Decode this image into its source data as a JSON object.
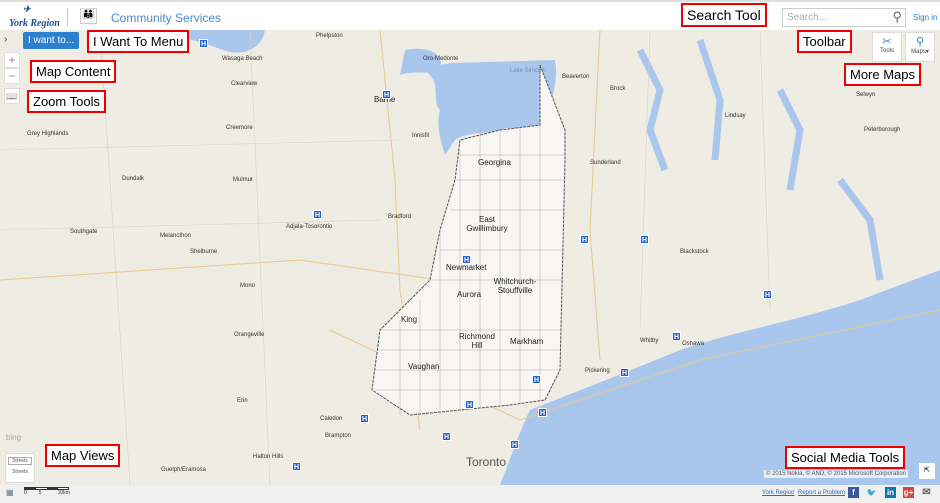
{
  "header": {
    "logo": "York Region",
    "title": "Community Services",
    "search_placeholder": "Search...",
    "sign_in": "Sign in"
  },
  "map": {
    "i_want_to": "I want to...",
    "toolbar": {
      "tools": "Tools",
      "maps": "Maps▾"
    },
    "zoom_in": "+",
    "zoom_out": "−",
    "bing": "bing",
    "streets_alt": "Streets",
    "streets": "Streets",
    "copyright": "© 2015 Nokia, © AND, © 2015 Microsoft Corporation",
    "municipalities": [
      "Georgina",
      "East Gwillimbury",
      "Newmarket",
      "Whitchurch-Stouffville",
      "Aurora",
      "King",
      "Richmond Hill",
      "Markham",
      "Vaughan",
      "Toronto"
    ],
    "places": [
      "Phelpston",
      "Oro-Medonte",
      "Wasaga Beach",
      "Clearview",
      "Barrie",
      "Beaverton",
      "Brock",
      "Lindsay",
      "Peterborough",
      "Creemore",
      "Grey Highlands",
      "Innisfil",
      "Mulmur",
      "Dundalk",
      "Bradford",
      "Melancthon",
      "Southgate",
      "Shelburne",
      "Mono",
      "Orangeville",
      "Caledon",
      "Brampton",
      "Pickering",
      "Whitby",
      "Oshawa",
      "Halton Hills",
      "Guelph/Eramosa",
      "Erin",
      "Adjala-Tosorontio",
      "Lake Simcoe",
      "Sunderland",
      "Selwyn",
      "Blackstock"
    ],
    "colors": {
      "land": "#efece4",
      "water": "#a9c6ec",
      "hospital": "#2563d9",
      "accent": "#2d7fd0"
    }
  },
  "footer": {
    "scale": [
      "0",
      "5",
      "10km"
    ],
    "links": [
      "York Region",
      "Report a Problem"
    ],
    "social": [
      "facebook-icon",
      "twitter-icon",
      "linkedin-icon",
      "googleplus-icon",
      "email-icon"
    ]
  },
  "annotations": [
    "Search Tool",
    "I Want To Menu",
    "Map Content",
    "Zoom Tools",
    "Toolbar",
    "More Maps",
    "Map Views",
    "Social Media Tools"
  ]
}
